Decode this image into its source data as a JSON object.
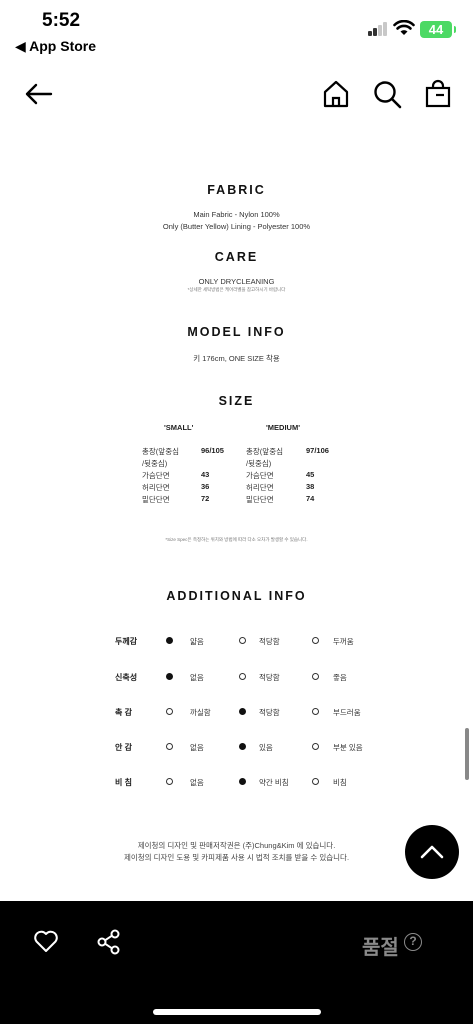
{
  "status": {
    "time": "5:52",
    "back_label": "◀ App Store",
    "battery": "44"
  },
  "fabric": {
    "title": "FABRIC",
    "line1": "Main Fabric  - Nylon 100%",
    "line2": "Only (Butter Yellow) Lining - Polyester 100%"
  },
  "care": {
    "title": "CARE",
    "line1": "ONLY DRYCLEANING",
    "note": "*상세한 세탁방법은 케어라벨을 참고하시기 바랍니다"
  },
  "model": {
    "title": "MODEL INFO",
    "line1": "키 176cm, ONE SIZE 착용"
  },
  "size": {
    "title": "SIZE",
    "small_head": "'SMALL'",
    "medium_head": "'MEDIUM'",
    "small_rows": [
      {
        "label": "총장(앞중심",
        "value": "96/105"
      },
      {
        "label": "/뒷중심)",
        "value": ""
      },
      {
        "label": "가슴단면",
        "value": "43"
      },
      {
        "label": "허리단면",
        "value": "36"
      },
      {
        "label": "밑단단면",
        "value": "72"
      }
    ],
    "medium_rows": [
      {
        "label": "총장(앞중심",
        "value": "97/106"
      },
      {
        "label": "/뒷중심)",
        "value": ""
      },
      {
        "label": "가슴단면",
        "value": "45"
      },
      {
        "label": "허리단면",
        "value": "38"
      },
      {
        "label": "밑단단면",
        "value": "74"
      }
    ],
    "note": "*Size Spec은 측정하는 위치와 방법에 따라 다소 오차가 발생할 수 있습니다."
  },
  "additional": {
    "title": "ADDITIONAL INFO",
    "rows": [
      {
        "label": "두께감",
        "opts": [
          "얇음",
          "적당함",
          "두꺼움"
        ],
        "selected": 0
      },
      {
        "label": "신축성",
        "opts": [
          "없음",
          "적당함",
          "좋음"
        ],
        "selected": 0
      },
      {
        "label": "촉 감",
        "opts": [
          "까실함",
          "적당함",
          "부드러움"
        ],
        "selected": 1
      },
      {
        "label": "안 감",
        "opts": [
          "없음",
          "있음",
          "부분 있음"
        ],
        "selected": 1
      },
      {
        "label": "비 침",
        "opts": [
          "없음",
          "약간 비침",
          "비침"
        ],
        "selected": 1
      }
    ]
  },
  "copyright": {
    "line1": "제이청의 디자인 및 판매저작권은 (주)Chung&Kim 에 있습니다.",
    "line2": "제이청의 디자인 도용 및 카피제품 사용 시 법적 조치를 받을 수 있습니다."
  },
  "bottom": {
    "soldout": "품절",
    "help": "?"
  }
}
